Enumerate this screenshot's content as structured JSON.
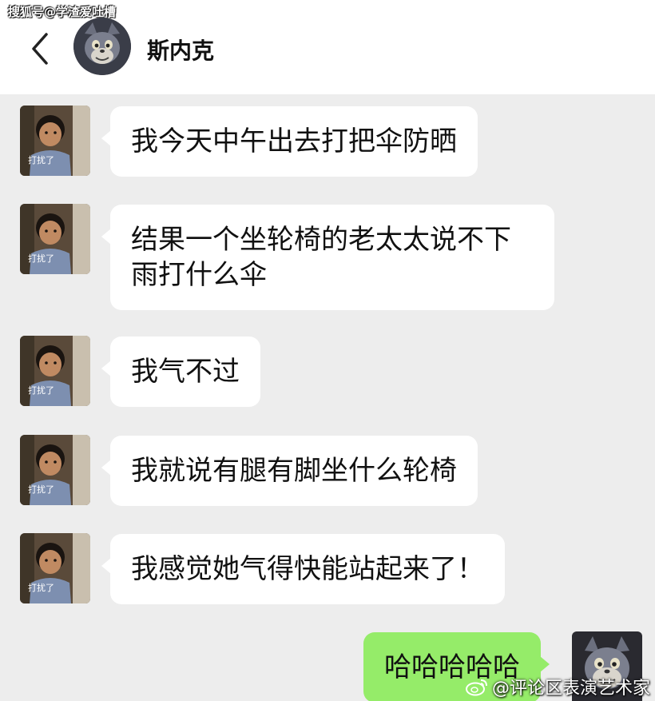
{
  "header": {
    "watermark": "搜狐号@学渣爱吐槽",
    "contact_name": "斯内克",
    "back_icon": "chevron-left-icon",
    "avatar_icon": "cartoon-cat-avatar"
  },
  "sticker": {
    "caption": "打扰了"
  },
  "messages": [
    {
      "from": "other",
      "text": "我今天中午出去打把伞防晒"
    },
    {
      "from": "other",
      "text": "结果一个坐轮椅的老太太说不下雨打什么伞"
    },
    {
      "from": "other",
      "text": "我气不过"
    },
    {
      "from": "other",
      "text": "我就说有腿有脚坐什么轮椅"
    },
    {
      "from": "other",
      "text": "我感觉她气得快能站起来了！"
    },
    {
      "from": "self",
      "text": "哈哈哈哈哈"
    }
  ],
  "footer": {
    "watermark": "@评论区表演艺术家",
    "weibo_icon": "weibo-logo-icon"
  },
  "colors": {
    "background": "#ededed",
    "bubble_other": "#ffffff",
    "bubble_self": "#95ec69",
    "header": "#ffffff"
  }
}
